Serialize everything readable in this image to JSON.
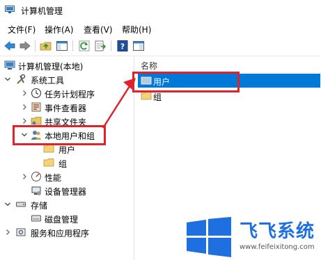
{
  "window": {
    "title": "计算机管理"
  },
  "menu": [
    "文件(F)",
    "操作(A)",
    "查看(V)",
    "帮助(H)"
  ],
  "toolbar": [
    "back-arrow-icon",
    "forward-arrow-icon",
    "folder-up-icon",
    "show-hide-tree-icon",
    "refresh-icon",
    "export-list-icon",
    "help-icon",
    "properties-icon"
  ],
  "tree": {
    "root": "计算机管理(本地)",
    "system_tools": "系统工具",
    "task_scheduler": "任务计划程序",
    "event_viewer": "事件查看器",
    "shared_folders": "共享文件夹",
    "local_users_groups": "本地用户和组",
    "users": "用户",
    "groups": "组",
    "performance": "性能",
    "device_manager": "设备管理器",
    "storage": "存储",
    "disk_management": "磁盘管理",
    "services_apps": "服务和应用程序"
  },
  "list": {
    "column_name": "名称",
    "items": [
      "用户",
      "组"
    ]
  },
  "watermark": {
    "brand": "飞飞系统",
    "url": "www.feifeixitong.com"
  },
  "colors": {
    "selection": "#0078d7",
    "highlight": "#e0232b",
    "brand": "#1e6fe0"
  }
}
